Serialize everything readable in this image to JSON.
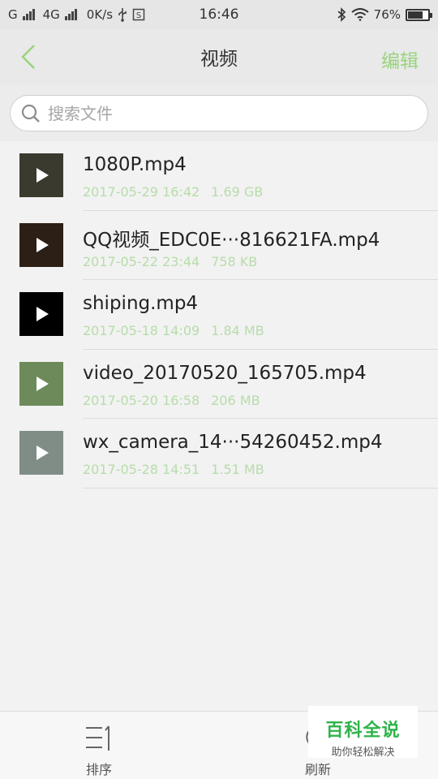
{
  "status_bar": {
    "carrier1": "G",
    "carrier2": "4G",
    "net_speed": "0K/s",
    "time": "16:46",
    "battery": "76%",
    "battery_level": 0.76
  },
  "header": {
    "title": "视频",
    "edit_label": "编辑"
  },
  "search": {
    "placeholder": "搜索文件"
  },
  "files": [
    {
      "name": "1080P.mp4",
      "date": "2017-05-29 16:42",
      "size": "1.69 GB",
      "thumb_color": "#3b3a2e"
    },
    {
      "name": "QQ视频_EDC0E···816621FA.mp4",
      "date": "2017-05-22 23:44",
      "size": "758 KB",
      "thumb_color": "#2b1f16"
    },
    {
      "name": "shiping.mp4",
      "date": "2017-05-18 14:09",
      "size": "1.84 MB",
      "thumb_color": "#000000"
    },
    {
      "name": "video_20170520_165705.mp4",
      "date": "2017-05-20 16:58",
      "size": "206 MB",
      "thumb_color": "#6d8a5a"
    },
    {
      "name": "wx_camera_14···54260452.mp4",
      "date": "2017-05-28 14:51",
      "size": "1.51 MB",
      "thumb_color": "#7f8d86"
    }
  ],
  "bottom_bar": {
    "sort_label": "排序",
    "refresh_label": "刷新"
  },
  "watermark": {
    "title": "百科全说",
    "subtitle": "助你轻松解决"
  },
  "colors": {
    "accent_green": "#98d47a",
    "meta_green": "#b7dcaa"
  }
}
